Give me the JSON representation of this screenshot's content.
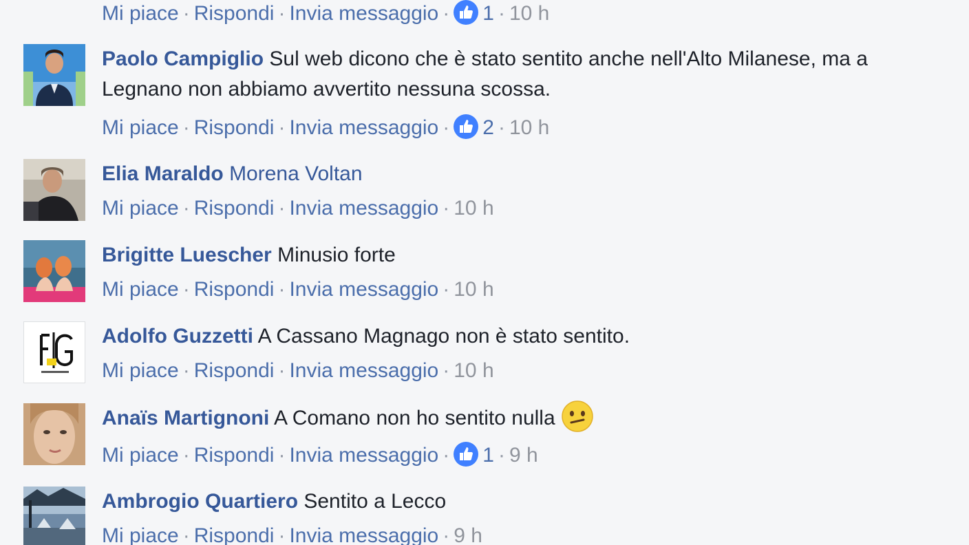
{
  "actions": {
    "like": "Mi piace",
    "reply": "Rispondi",
    "message": "Invia messaggio",
    "separator": "·"
  },
  "icons": {
    "like": "thumbs-up-icon",
    "confused_emoji": "confused-face-icon"
  },
  "colors": {
    "author": "#365899",
    "link": "#4b6eab",
    "like_badge": "#4080ff",
    "time": "#90949c",
    "background": "#f5f6f8"
  },
  "comments": [
    {
      "like_count": "1",
      "time": "10 h"
    },
    {
      "author": "Paolo Campiglio",
      "text": "Sul web dicono che è stato sentito anche nell'Alto Milanese, ma a Legnano non abbiamo avvertito nessuna scossa.",
      "like_count": "2",
      "time": "10 h"
    },
    {
      "author": "Elia Maraldo",
      "text": "Morena Voltan",
      "time": "10 h"
    },
    {
      "author": "Brigitte Luescher",
      "text": "Minusio forte",
      "time": "10 h"
    },
    {
      "author": "Adolfo Guzzetti",
      "text": "A Cassano Magnago non è stato sentito.",
      "time": "10 h"
    },
    {
      "author": "Anaïs Martignoni",
      "text": "A Comano non ho sentito nulla",
      "like_count": "1",
      "time": "9 h"
    },
    {
      "author": "Ambrogio Quartiero",
      "text": "Sentito a Lecco",
      "time": "9 h"
    }
  ]
}
